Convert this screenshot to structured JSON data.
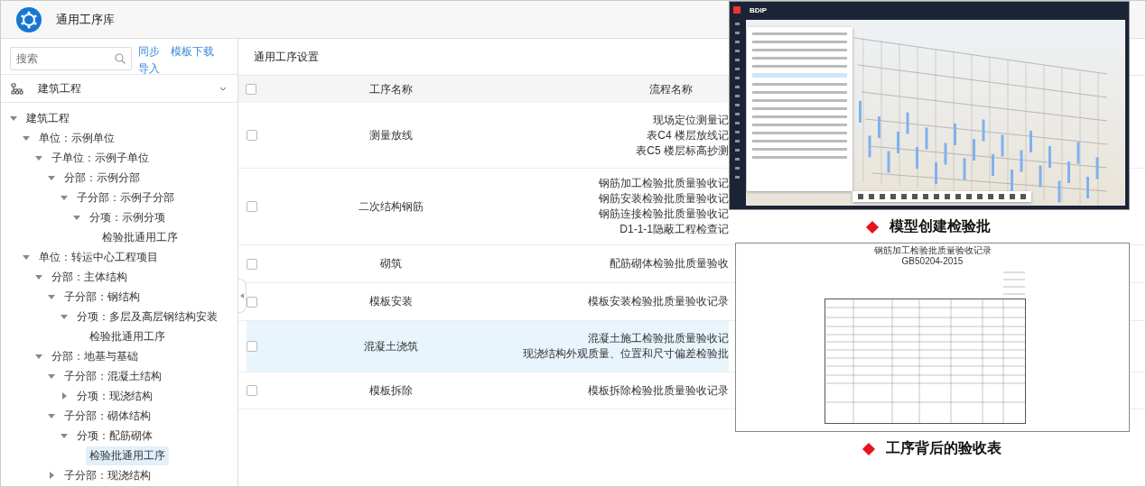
{
  "header": {
    "title": "通用工序库"
  },
  "sidebar": {
    "search": {
      "placeholder": "搜索"
    },
    "links": [
      "同步",
      "模板下载",
      "导入"
    ],
    "selector": {
      "value": "建筑工程"
    },
    "tree": [
      {
        "label": "建筑工程",
        "expanded": true,
        "selected": false,
        "children": [
          {
            "label": "单位：示例单位",
            "expanded": true,
            "selected": false,
            "children": [
              {
                "label": "子单位：示例子单位",
                "expanded": true,
                "selected": false,
                "children": [
                  {
                    "label": "分部：示例分部",
                    "expanded": true,
                    "selected": false,
                    "children": [
                      {
                        "label": "子分部：示例子分部",
                        "expanded": true,
                        "selected": false,
                        "children": [
                          {
                            "label": "分项：示例分项",
                            "expanded": true,
                            "selected": false,
                            "children": [
                              {
                                "label": "检验批通用工序",
                                "selected": false
                              }
                            ]
                          }
                        ]
                      }
                    ]
                  }
                ]
              }
            ]
          },
          {
            "label": "单位：转运中心工程项目",
            "expanded": true,
            "selected": false,
            "children": [
              {
                "label": "分部：主体结构",
                "expanded": true,
                "selected": false,
                "children": [
                  {
                    "label": "子分部：钢结构",
                    "expanded": true,
                    "selected": false,
                    "children": [
                      {
                        "label": "分项：多层及高层钢结构安装",
                        "expanded": true,
                        "selected": false,
                        "children": [
                          {
                            "label": "检验批通用工序",
                            "selected": false
                          }
                        ]
                      }
                    ]
                  }
                ]
              },
              {
                "label": "分部：地基与基础",
                "expanded": true,
                "selected": false,
                "children": [
                  {
                    "label": "子分部：混凝土结构",
                    "expanded": true,
                    "selected": false,
                    "children": [
                      {
                        "label": "分项：现浇结构",
                        "expanded": false,
                        "selected": false
                      }
                    ]
                  },
                  {
                    "label": "子分部：砌体结构",
                    "expanded": true,
                    "selected": false,
                    "children": [
                      {
                        "label": "分项：配筋砌体",
                        "expanded": true,
                        "selected": false,
                        "children": [
                          {
                            "label": "检验批通用工序",
                            "selected": true
                          }
                        ]
                      }
                    ]
                  },
                  {
                    "label": "子分部：现浇结构",
                    "expanded": false,
                    "selected": false
                  }
                ]
              }
            ]
          }
        ]
      }
    ]
  },
  "main": {
    "title": "通用工序设置",
    "table": {
      "columns": [
        "工序名称",
        "流程名称"
      ],
      "all_checked": false,
      "rows": [
        {
          "name": "测量放线",
          "flows": [
            "现场定位测量记",
            "表C4 楼层放线记",
            "表C5 楼层标高抄测"
          ],
          "checked": false,
          "selected": false
        },
        {
          "name": "二次结构钢筋",
          "flows": [
            "钢筋加工检验批质量验收记",
            "钢筋安装检验批质量验收记",
            "钢筋连接检验批质量验收记",
            "D1-1-1隐蔽工程检查记"
          ],
          "checked": false,
          "selected": false
        },
        {
          "name": "砌筑",
          "flows": [
            "配筋砌体检验批质量验收"
          ],
          "checked": false,
          "selected": false
        },
        {
          "name": "模板安装",
          "flows": [
            "模板安装检验批质量验收记录"
          ],
          "checked": false,
          "selected": false
        },
        {
          "name": "混凝土浇筑",
          "flows": [
            "混凝土施工检验批质量验收记",
            "现浇结构外观质量、位置和尺寸偏差检验批"
          ],
          "checked": false,
          "selected": true
        },
        {
          "name": "模板拆除",
          "flows": [
            "模板拆除检验批质量验收记录"
          ],
          "checked": false,
          "selected": false
        }
      ]
    }
  },
  "overlays": [
    {
      "kind": "model_viewer",
      "app_name": "BDIP",
      "caption": "模型创建检验批"
    },
    {
      "kind": "form",
      "form_title": "钢筋加工检验批质量验收记录",
      "form_code": "GB50204-2015",
      "caption": "工序背后的验收表"
    }
  ]
}
